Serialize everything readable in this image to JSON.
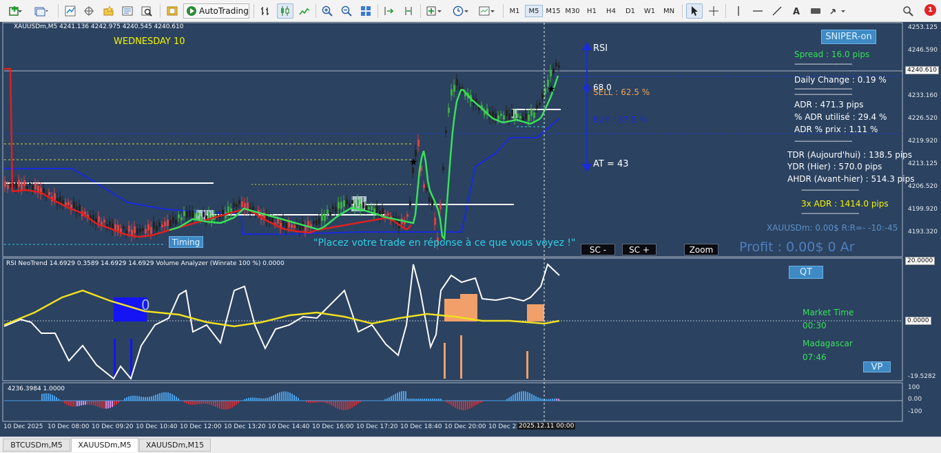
{
  "toolbar": {
    "autotrading_label": "AutoTrading",
    "timeframes": [
      "M1",
      "M5",
      "M15",
      "M30",
      "H1",
      "H4",
      "D1",
      "W1",
      "MN"
    ],
    "active_timeframe": "M5",
    "notification_count": "1"
  },
  "chart": {
    "symbol_info": "XAUUSDm,M5  4241.136 4242.975 4240.545 4240.610",
    "day_label": "WEDNESDAY 10",
    "rsi_label": "RSI",
    "rsi_value": "68.0",
    "sell_label": "SELL : 62.5 %",
    "buy_label": "BUY : 37.5 %",
    "at_label": "AT = 43",
    "sniper_button": "SNIPER-on",
    "timing_button": "Timing",
    "message": "\"Placez votre trade en réponse à ce que vous voyez !\"",
    "sc_minus": "SC -",
    "sc_plus": "SC +",
    "zoom_button": "Zoom",
    "profit": "Profit : 0.00$  0 Ar",
    "account_info": "XAUUSDm: 0.00$  R:R=-  -10:-45",
    "stats": {
      "spread": "Spread : 16.0 pips",
      "daily_change": "Daily Change : 0.19 %",
      "adr": "ADR : 471.3 pips",
      "adr_used": "% ADR utilisé : 29.4 %",
      "adr_price": "ADR % prix : 1.11 %",
      "tdr": "TDR (Aujourd'hui) : 138.5 pips",
      "ydr": "YDR (Hier) : 570.0 pips",
      "ahdr": "AHDR (Avant-hier) : 514.3 pips",
      "three_adr": "3x ADR : 1414.0 pips",
      "dashes": "--------------------------------"
    },
    "price_ticks": [
      "4253.125",
      "4246.590",
      "4233.160",
      "4226.520",
      "4219.920",
      "4213.125",
      "4206.520",
      "4199.920",
      "4193.320"
    ],
    "current_price": "4240.610",
    "colors": {
      "bull": "#3cb043",
      "bear": "#d41e1e",
      "ma_up": "#39e05a",
      "ma_down": "#e02020",
      "support": "#1a2bdc"
    }
  },
  "indicator1": {
    "title": "RSI NeoTrend 14.6929 0.3589 14.6929 14.6929  Volume Analyzer (Winrate 100 %) 0.0000",
    "qt_button": "QT",
    "market_time_label": "Market Time",
    "market_time": "00:30",
    "location_label": "Madagascar",
    "location_time": "07:46",
    "vp_button": "VP",
    "top_value": "20.0000",
    "zero_value": "0.0000",
    "bottom_value": "-19.5282"
  },
  "indicator2": {
    "title": "4236.3984 1.0000",
    "ticks": [
      "100",
      "0.00",
      "-100"
    ]
  },
  "time_axis": {
    "labels": [
      "10 Dec 2025",
      "10 Dec 08:00",
      "10 Dec 09:20",
      "10 Dec 10:40",
      "10 Dec 12:00",
      "10 Dec 13:20",
      "10 Dec 14:40",
      "10 Dec 16:00",
      "10 Dec 17:20",
      "10 Dec 18:40",
      "10 Dec 20:00",
      "10 Dec 21"
    ],
    "cursor_time": "2025.12.11 00:00"
  },
  "tabs": [
    "BTCUSDm,M5",
    "XAUUSDm,M5",
    "XAUUSDm,M15"
  ],
  "active_tab": "XAUUSDm,M5"
}
